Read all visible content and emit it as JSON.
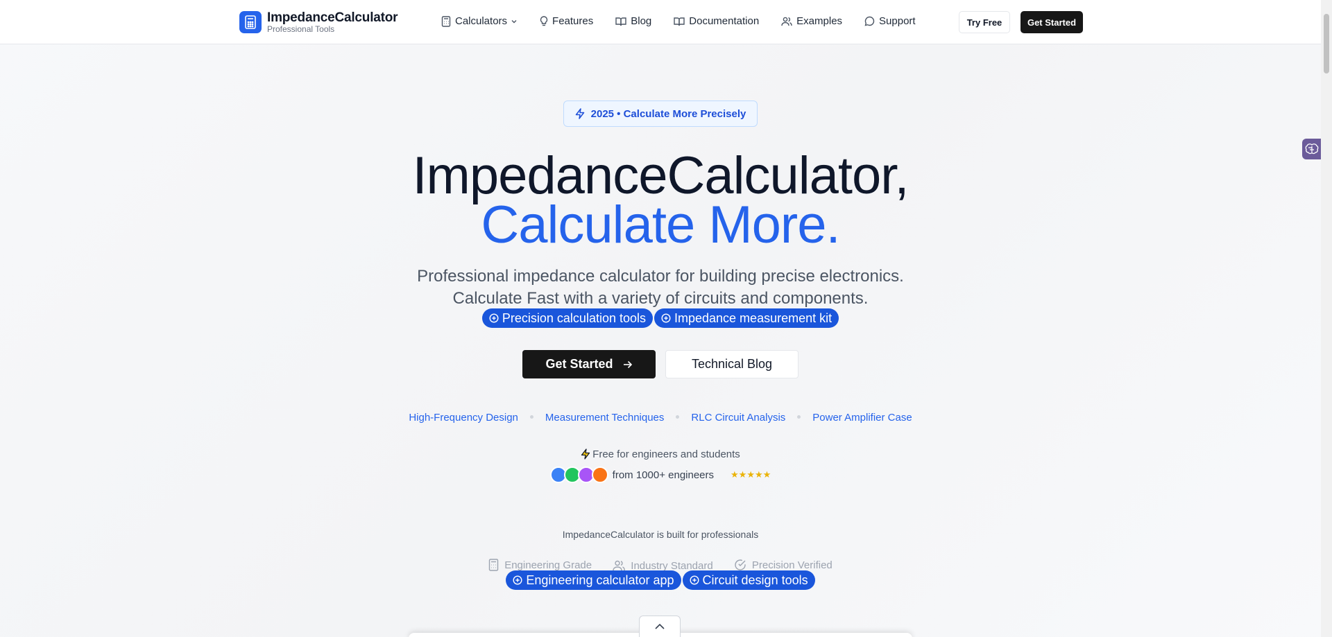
{
  "header": {
    "logo_title": "ImpedanceCalculator",
    "logo_subtitle": "Professional Tools",
    "nav": [
      {
        "label": "Calculators",
        "icon": "calculator-icon"
      },
      {
        "label": "Features",
        "icon": "lightbulb-icon"
      },
      {
        "label": "Blog",
        "icon": "book-open-icon"
      },
      {
        "label": "Documentation",
        "icon": "book-open-icon"
      },
      {
        "label": "Examples",
        "icon": "users-icon"
      },
      {
        "label": "Support",
        "icon": "message-circle-icon"
      }
    ],
    "try_free": "Try Free",
    "get_started": "Get Started"
  },
  "hero": {
    "badge": "2025 • Calculate More Precisely",
    "title_line1": "ImpedanceCalculator,",
    "title_line2": "Calculate More.",
    "subtitle_line1": "Professional impedance calculator for building precise electronics.",
    "subtitle_line2": "Calculate Fast with a variety of circuits and components.",
    "pills": [
      "Precision calculation tools",
      "Impedance measurement kit"
    ],
    "cta_primary": "Get Started",
    "cta_secondary": "Technical Blog",
    "topics": [
      "High-Frequency Design",
      "Measurement Techniques",
      "RLC Circuit Analysis",
      "Power Amplifier Case"
    ],
    "free_note": "Free for engineers and students",
    "engineers_text": "from 1000+ engineers",
    "stars": "★★★★★",
    "avatar_colors": [
      "#3b82f6",
      "#22c55e",
      "#a855f7",
      "#f97316"
    ]
  },
  "trust": {
    "built_for": "ImpedanceCalculator is built for professionals",
    "features": [
      {
        "label": "Engineering Grade",
        "icon": "calculator-icon"
      },
      {
        "label": "Industry Standard",
        "icon": "users-icon"
      },
      {
        "label": "Precision Verified",
        "icon": "check-circle-icon"
      }
    ],
    "pills": [
      "Engineering calculator app",
      "Circuit design tools"
    ]
  },
  "colors": {
    "accent": "#2563eb",
    "pill": "#1a56db",
    "dark_button": "#171717"
  }
}
